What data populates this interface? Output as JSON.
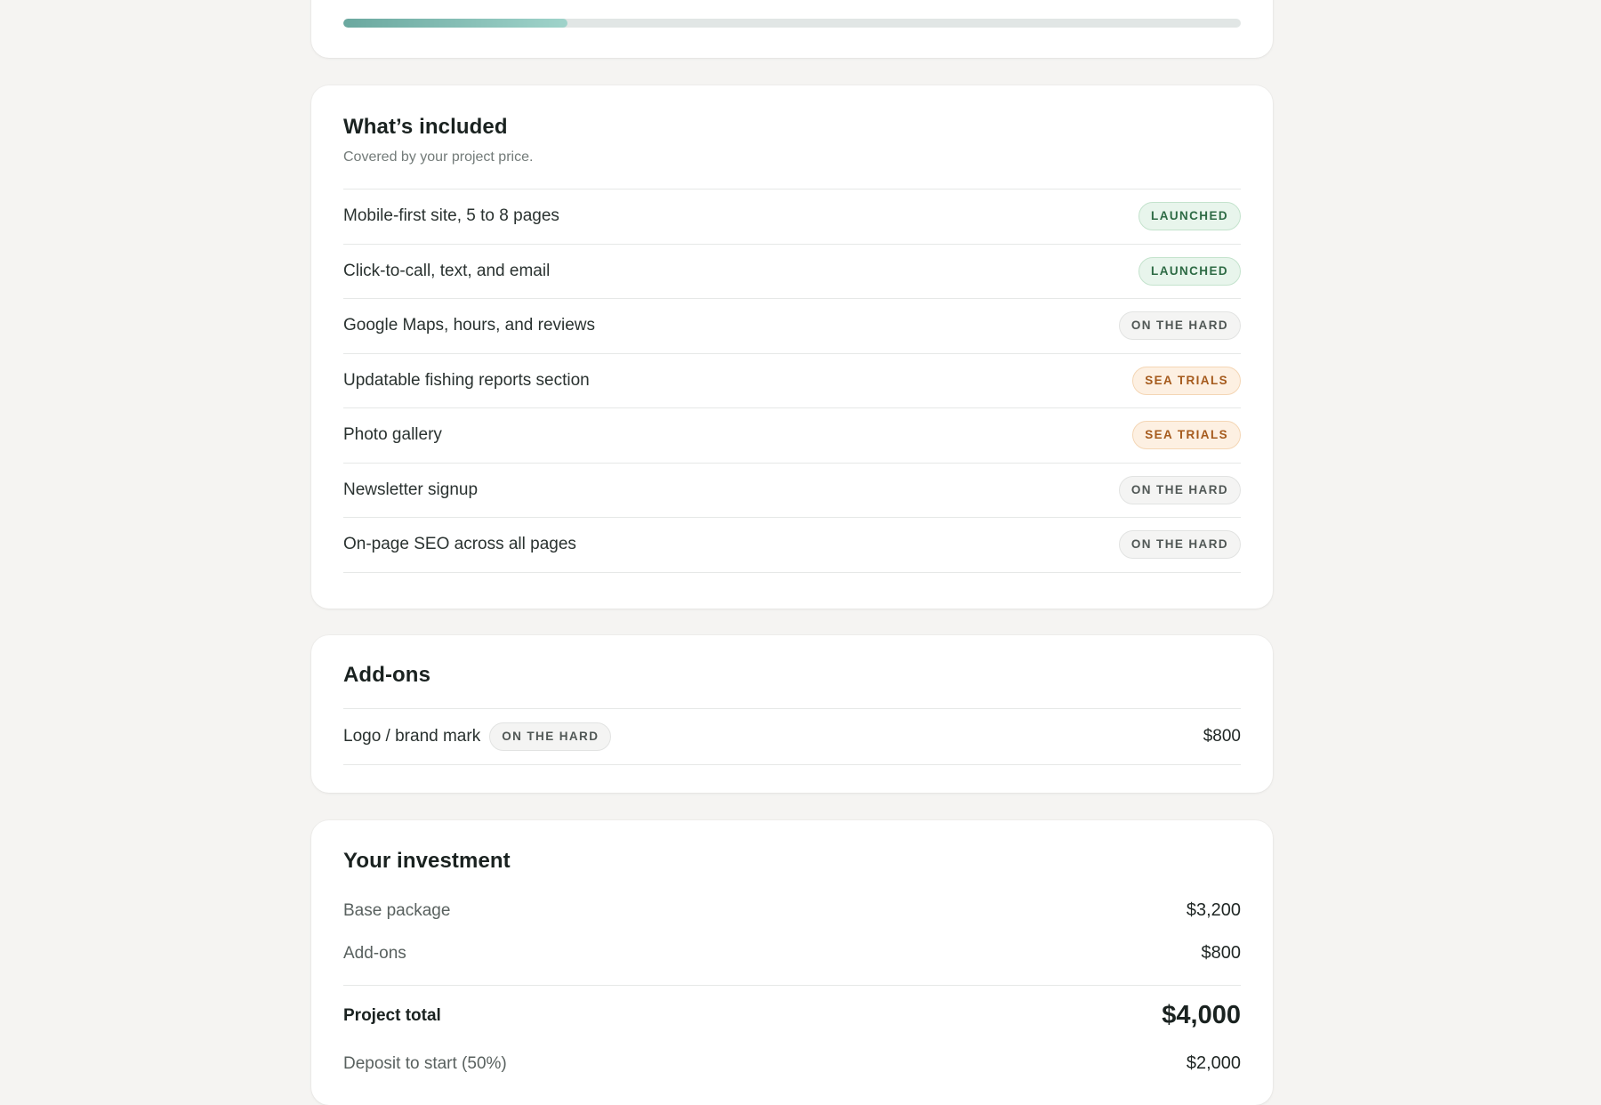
{
  "progress": {
    "fill_percent": 25
  },
  "included": {
    "title": "What’s included",
    "subtitle": "Covered by your project price.",
    "items": [
      {
        "label": "Mobile-first site, 5 to 8 pages",
        "status": "LAUNCHED"
      },
      {
        "label": "Click-to-call, text, and email",
        "status": "LAUNCHED"
      },
      {
        "label": "Google Maps, hours, and reviews",
        "status": "ON THE HARD"
      },
      {
        "label": "Updatable fishing reports section",
        "status": "SEA TRIALS"
      },
      {
        "label": "Photo gallery",
        "status": "SEA TRIALS"
      },
      {
        "label": "Newsletter signup",
        "status": "ON THE HARD"
      },
      {
        "label": "On-page SEO across all pages",
        "status": "ON THE HARD"
      }
    ]
  },
  "addons": {
    "title": "Add-ons",
    "items": [
      {
        "label": "Logo / brand mark",
        "status": "ON THE HARD",
        "price": "$800"
      }
    ]
  },
  "investment": {
    "title": "Your investment",
    "base_label": "Base package",
    "base_value": "$3,200",
    "addons_label": "Add-ons",
    "addons_value": "$800",
    "total_label": "Project total",
    "total_value": "$4,000",
    "deposit_label": "Deposit to start (50%)",
    "deposit_value": "$2,000"
  },
  "colors": {
    "background": "#f5f4f2",
    "card": "#ffffff",
    "progress_fill_start": "#6aa89f",
    "progress_fill_end": "#9fd3ca",
    "badge_launched": "#2e6b45",
    "badge_hard": "#505755",
    "badge_trials": "#a55a1c"
  }
}
